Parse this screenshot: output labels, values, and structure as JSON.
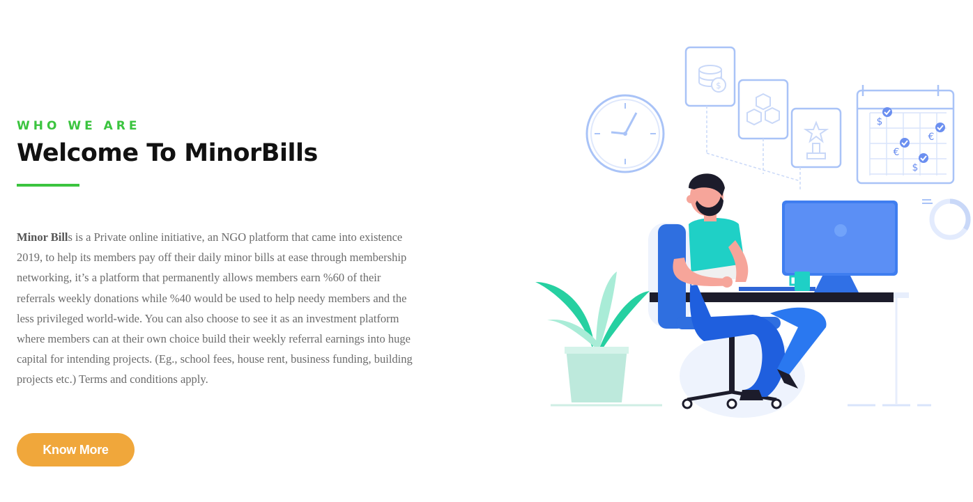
{
  "section": {
    "eyebrow": "WHO WE ARE",
    "title": "Welcome To MinorBills",
    "description_bold": "Minor Bill",
    "description_rest": "s is a Private online initiative, an NGO platform that came into existence 2019, to help its members pay off their daily minor bills at ease through membership networking, it’s a  platform that permanently allows members earn %60 of their referrals weekly donations while %40 would be used to help needy  members and the less privileged world-wide. You can also choose to see it as an investment platform  where members can at their own choice build their weekly referral earnings into huge capital for intending projects. (Eg., school fees, house rent, business funding, building projects etc.) Terms and conditions apply.",
    "button_label": "Know More"
  },
  "illustration": {
    "calendar_symbols": [
      "$",
      "€",
      "€",
      "$"
    ],
    "coin_symbol": "$"
  },
  "colors": {
    "accent_green": "#3bc43f",
    "button_orange": "#f0a73b",
    "title": "#111111",
    "body_text": "#6b6b6b"
  }
}
